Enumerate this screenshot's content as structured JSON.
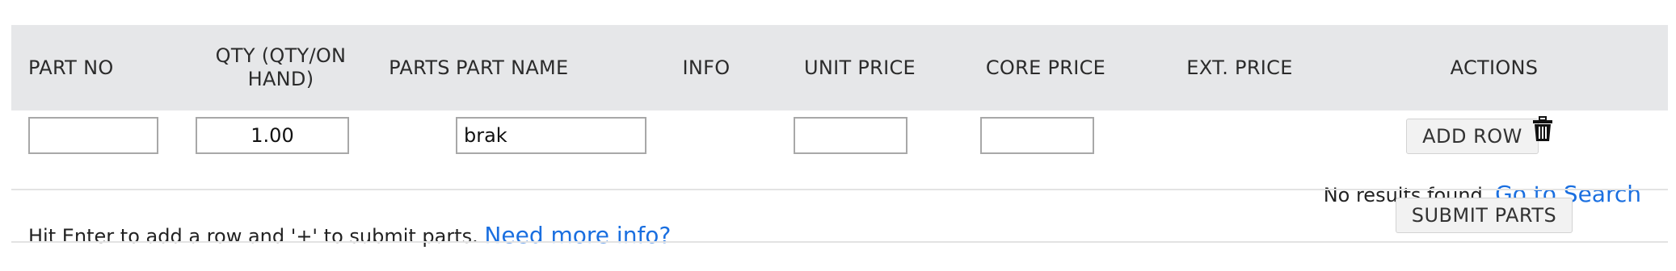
{
  "table": {
    "columns": {
      "part_no": "PART NO",
      "qty": "QTY (QTY/ON HAND)",
      "parts": "PARTS",
      "part_name": "PART NAME",
      "info": "INFO",
      "unit_price": "UNIT PRICE",
      "core_price": "CORE PRICE",
      "ext_price": "EXT. PRICE",
      "actions": "ACTIONS"
    },
    "row": {
      "part_no_value": "",
      "qty_value": "1.00",
      "part_name_value": "brak",
      "unit_price_value": "",
      "core_price_value": "",
      "add_row_label": "ADD ROW",
      "no_results_text": "No results found.",
      "go_to_search_link": "Go to Search",
      "delete_icon": "trash-icon"
    }
  },
  "footer": {
    "hint_text": "Hit Enter to add a row and '+' to submit parts.",
    "help_link": "Need more info?",
    "submit_label": "SUBMIT PARTS"
  },
  "colors": {
    "header_bg": "#e6e7e9",
    "link": "#1a6fe0",
    "button_bg": "#f2f2f2"
  }
}
